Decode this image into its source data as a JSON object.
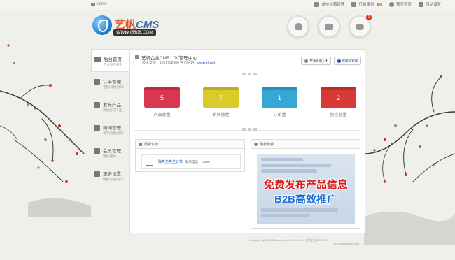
{
  "topbar": {
    "site_label": "i5808",
    "items": [
      {
        "label": "单位供稿管理",
        "icon": "document-icon"
      },
      {
        "label": "订单服务",
        "icon": "mail-icon",
        "badge": "0"
      },
      {
        "label": "预览首页",
        "icon": "cloud-icon"
      },
      {
        "label": "网站设置",
        "icon": "settings-sliders-icon"
      }
    ]
  },
  "logo": {
    "brand_cn": "艺帆",
    "brand_en": "CMS",
    "url": "WWW.i5808.COM"
  },
  "actions": [
    {
      "name": "user-icon"
    },
    {
      "name": "truck-icon"
    },
    {
      "name": "chat-icon",
      "badge": "2"
    }
  ],
  "sidebar": [
    {
      "title": "后台首页",
      "sub": "后台综合服务",
      "icon": "home-icon",
      "active": true
    },
    {
      "title": "订单管理",
      "sub": "查看/处理/删除",
      "icon": "mail-icon"
    },
    {
      "title": "发布产品",
      "sub": "添加发布产品",
      "icon": "edit-icon"
    },
    {
      "title": "新闻管理",
      "sub": "发布/管理/删除",
      "icon": "news-icon"
    },
    {
      "title": "会员管理",
      "sub": "审核/删除",
      "icon": "members-icon"
    },
    {
      "title": "更多设置",
      "sub": "模板/下载/统计",
      "icon": "chart-icon"
    }
  ],
  "panel": {
    "title": "艺帆企业CMS1.0V管理中心",
    "info_prefix": "技术支持：1051758686  官方网站：",
    "info_link": "www.xlj.net",
    "more_settings": "更多设置",
    "admin_button": "管理员管理"
  },
  "stats": [
    {
      "value": "5",
      "label": "产品总量",
      "color": "#d9364f"
    },
    {
      "value": "7",
      "label": "新闻总量",
      "color": "#d9cb2a"
    },
    {
      "value": "1",
      "label": "订单量",
      "color": "#35a9d4"
    },
    {
      "value": "2",
      "label": "留言总量",
      "color": "#d63a35"
    }
  ],
  "latest_order": {
    "title": "最新订单",
    "customer": "陈先生先生订单",
    "phone": "联系电话：18180"
  },
  "template_box": {
    "title": "最新模板",
    "ad_line1": "免费发布产品信息",
    "ad_line2": "B2B高效推广"
  },
  "footer": {
    "line1": "Copyright fight © 2012 www.xlj.net Powered By 艺帆企业CMS1.0V",
    "line2": "1051758686@qq.com"
  }
}
